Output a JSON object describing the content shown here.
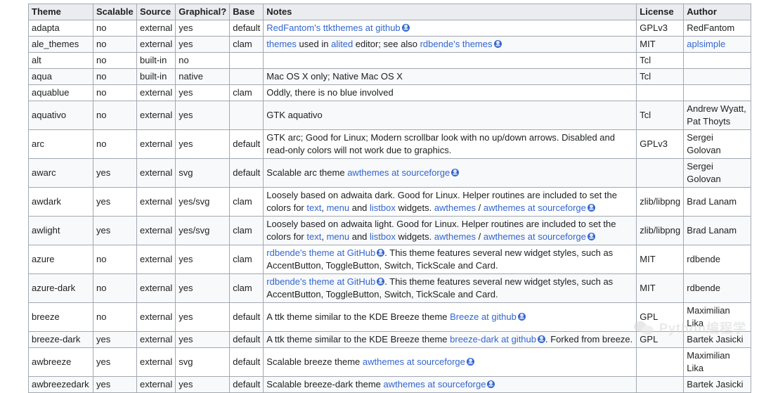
{
  "headers": [
    "Theme",
    "Scalable",
    "Source",
    "Graphical?",
    "Base",
    "Notes",
    "License",
    "Author"
  ],
  "rows": [
    {
      "theme": "adapta",
      "scalable": "no",
      "source": "external",
      "graphical": "yes",
      "base": "default",
      "notes": [
        {
          "t": "RedFantom's ttkthemes at github",
          "link": true,
          "globe": true
        }
      ],
      "license": "GPLv3",
      "author": [
        {
          "t": "RedFantom"
        }
      ]
    },
    {
      "theme": "ale_themes",
      "scalable": "no",
      "source": "external",
      "graphical": "yes",
      "base": "clam",
      "notes": [
        {
          "t": "themes",
          "link": true
        },
        {
          "t": " used in "
        },
        {
          "t": "alited",
          "link": true
        },
        {
          "t": " editor; see also "
        },
        {
          "t": "rdbende's themes",
          "link": true,
          "globe": true
        }
      ],
      "license": "MIT",
      "author": [
        {
          "t": "aplsimple",
          "link": true
        }
      ]
    },
    {
      "theme": "alt",
      "scalable": "no",
      "source": "built-in",
      "graphical": "no",
      "base": "",
      "notes": [],
      "license": "Tcl",
      "author": []
    },
    {
      "theme": "aqua",
      "scalable": "no",
      "source": "built-in",
      "graphical": "native",
      "base": "",
      "notes": [
        {
          "t": "Mac OS X only; Native Mac OS X"
        }
      ],
      "license": "Tcl",
      "author": []
    },
    {
      "theme": "aquablue",
      "scalable": "no",
      "source": "external",
      "graphical": "yes",
      "base": "clam",
      "notes": [
        {
          "t": "Oddly, there is no blue involved"
        }
      ],
      "license": "",
      "author": []
    },
    {
      "theme": "aquativo",
      "scalable": "no",
      "source": "external",
      "graphical": "yes",
      "base": "",
      "notes": [
        {
          "t": "GTK aquativo"
        }
      ],
      "license": "Tcl",
      "author": [
        {
          "t": "Andrew Wyatt, Pat Thoyts"
        }
      ]
    },
    {
      "theme": "arc",
      "scalable": "no",
      "source": "external",
      "graphical": "yes",
      "base": "default",
      "notes": [
        {
          "t": "GTK arc; Good for Linux; Modern scrollbar look with no up/down arrows. Disabled and read-only colors will not work due to graphics."
        }
      ],
      "license": "GPLv3",
      "author": [
        {
          "t": "Sergei Golovan"
        }
      ]
    },
    {
      "theme": "awarc",
      "scalable": "yes",
      "source": "external",
      "graphical": "svg",
      "base": "default",
      "notes": [
        {
          "t": "Scalable arc theme "
        },
        {
          "t": "awthemes at sourceforge",
          "link": true,
          "globe": true
        }
      ],
      "license": "",
      "author": [
        {
          "t": "Sergei Golovan"
        }
      ]
    },
    {
      "theme": "awdark",
      "scalable": "yes",
      "source": "external",
      "graphical": "yes/svg",
      "base": "clam",
      "notes": [
        {
          "t": "Loosely based on adwaita dark. Good for Linux. Helper routines are included to set the colors for "
        },
        {
          "t": "text",
          "link": true
        },
        {
          "t": ", "
        },
        {
          "t": "menu",
          "link": true
        },
        {
          "t": " and "
        },
        {
          "t": "listbox",
          "link": true
        },
        {
          "t": " widgets. "
        },
        {
          "t": "awthemes",
          "link": true
        },
        {
          "t": " / "
        },
        {
          "t": "awthemes at sourceforge",
          "link": true,
          "globe": true
        }
      ],
      "license": "zlib/libpng",
      "author": [
        {
          "t": "Brad Lanam"
        }
      ]
    },
    {
      "theme": "awlight",
      "scalable": "yes",
      "source": "external",
      "graphical": "yes/svg",
      "base": "clam",
      "notes": [
        {
          "t": "Loosely based on adwaita light. Good for Linux. Helper routines are included to set the colors for "
        },
        {
          "t": "text",
          "link": true
        },
        {
          "t": ", "
        },
        {
          "t": "menu",
          "link": true
        },
        {
          "t": " and "
        },
        {
          "t": "listbox",
          "link": true
        },
        {
          "t": " widgets. "
        },
        {
          "t": "awthemes",
          "link": true
        },
        {
          "t": " / "
        },
        {
          "t": "awthemes at sourceforge",
          "link": true,
          "globe": true
        }
      ],
      "license": "zlib/libpng",
      "author": [
        {
          "t": "Brad Lanam"
        }
      ]
    },
    {
      "theme": "azure",
      "scalable": "no",
      "source": "external",
      "graphical": "yes",
      "base": "clam",
      "notes": [
        {
          "t": "rdbende's theme at GitHub",
          "link": true,
          "globe": true
        },
        {
          "t": ". This theme features several new widget styles, such as AccentButton, ToggleButton, Switch, TickScale and Card."
        }
      ],
      "license": "MIT",
      "author": [
        {
          "t": "rdbende"
        }
      ]
    },
    {
      "theme": "azure-dark",
      "scalable": "no",
      "source": "external",
      "graphical": "yes",
      "base": "clam",
      "notes": [
        {
          "t": "rdbende's theme at GitHub",
          "link": true,
          "globe": true
        },
        {
          "t": ". This theme features several new widget styles, such as AccentButton, ToggleButton, Switch, TickScale and Card."
        }
      ],
      "license": "MIT",
      "author": [
        {
          "t": "rdbende"
        }
      ]
    },
    {
      "theme": "breeze",
      "scalable": "no",
      "source": "external",
      "graphical": "yes",
      "base": "default",
      "notes": [
        {
          "t": "A ttk theme similar to the KDE Breeze theme "
        },
        {
          "t": "Breeze at github",
          "link": true,
          "globe": true
        }
      ],
      "license": "GPL",
      "author": [
        {
          "t": "Maximilian Lika"
        }
      ]
    },
    {
      "theme": "breeze-dark",
      "scalable": "yes",
      "source": "external",
      "graphical": "yes",
      "base": "default",
      "notes": [
        {
          "t": "A ttk theme similar to the KDE Breeze theme "
        },
        {
          "t": "breeze-dark at github",
          "link": true,
          "globe": true
        },
        {
          "t": ". Forked from breeze."
        }
      ],
      "license": "GPL",
      "author": [
        {
          "t": "Bartek Jasicki"
        }
      ]
    },
    {
      "theme": "awbreeze",
      "scalable": "yes",
      "source": "external",
      "graphical": "svg",
      "base": "default",
      "notes": [
        {
          "t": "Scalable breeze theme "
        },
        {
          "t": "awthemes at sourceforge",
          "link": true,
          "globe": true
        }
      ],
      "license": "",
      "author": [
        {
          "t": "Maximilian Lika"
        }
      ]
    },
    {
      "theme": "awbreezedark",
      "scalable": "yes",
      "source": "external",
      "graphical": "yes",
      "base": "default",
      "notes": [
        {
          "t": "Scalable breeze-dark theme "
        },
        {
          "t": "awthemes at sourceforge",
          "link": true,
          "globe": true
        }
      ],
      "license": "",
      "author": [
        {
          "t": "Bartek Jasicki"
        }
      ]
    }
  ],
  "watermark": {
    "text": "Python编程学"
  },
  "colors": {
    "link": "#3366cc",
    "header_bg": "#eaecf0",
    "border": "#a2a9b1"
  }
}
